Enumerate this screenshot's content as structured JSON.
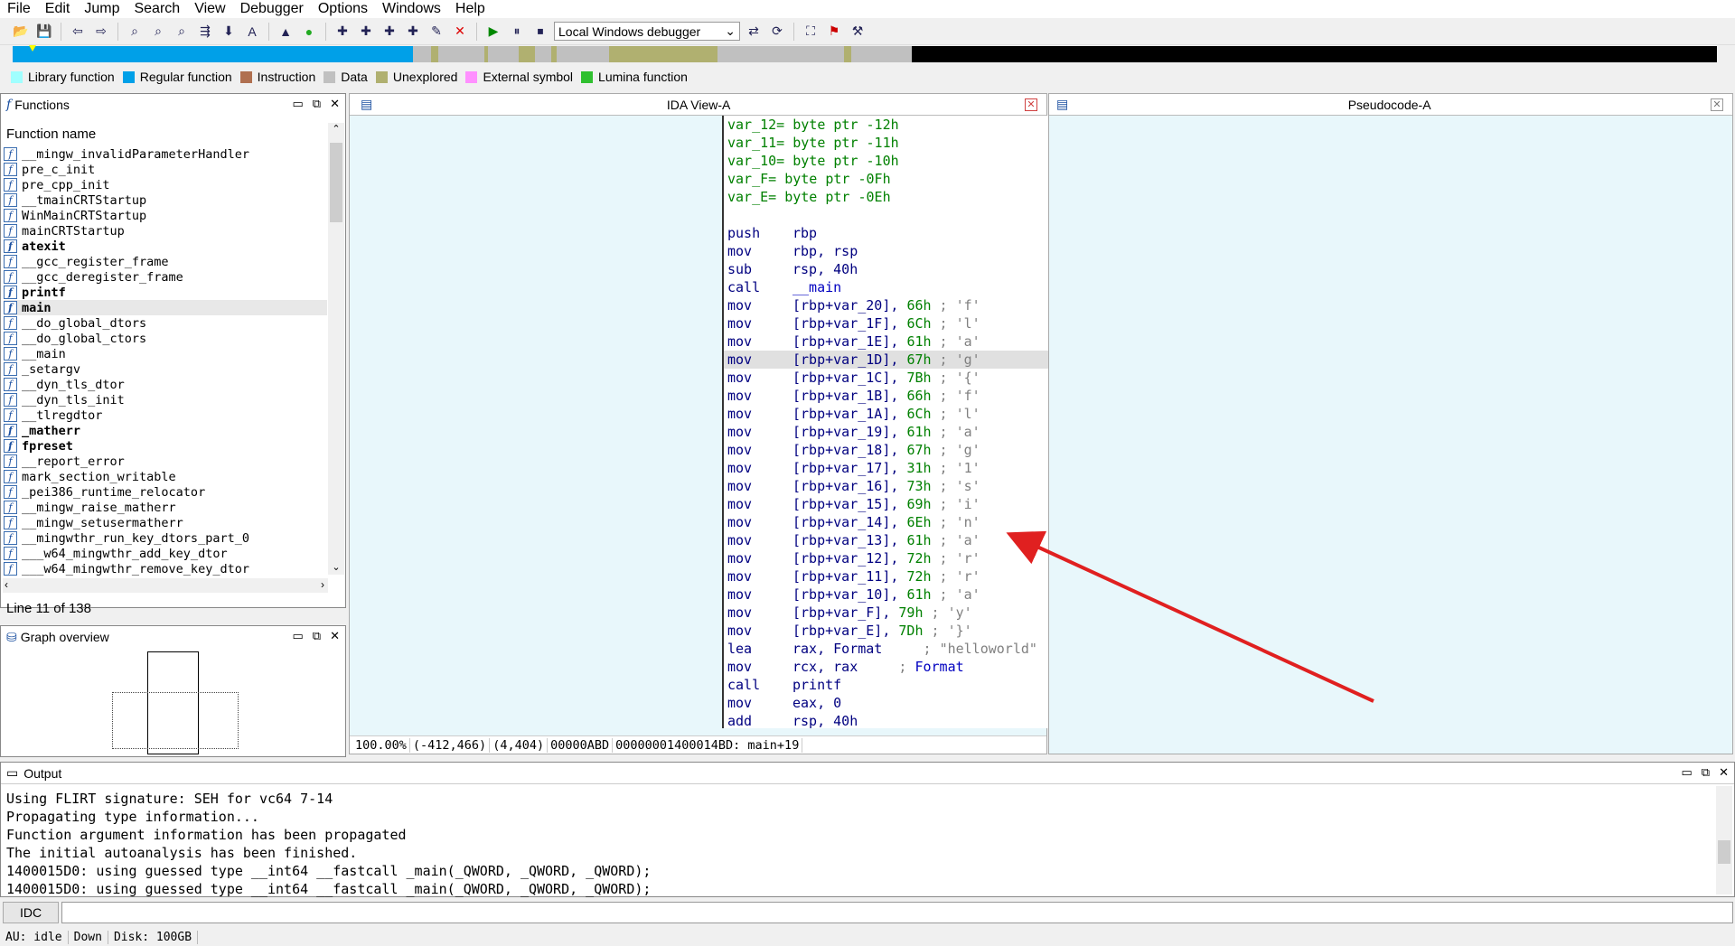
{
  "menu": [
    "File",
    "Edit",
    "Jump",
    "Search",
    "View",
    "Debugger",
    "Options",
    "Windows",
    "Help"
  ],
  "toolbar": {
    "debugger_select": "Local Windows debugger"
  },
  "legend": [
    {
      "label": "Library function",
      "color": "#a0ffff"
    },
    {
      "label": "Regular function",
      "color": "#00a0e8"
    },
    {
      "label": "Instruction",
      "color": "#b07050"
    },
    {
      "label": "Data",
      "color": "#c0c0c0"
    },
    {
      "label": "Unexplored",
      "color": "#b0b070"
    },
    {
      "label": "External symbol",
      "color": "#ff90ff"
    },
    {
      "label": "Lumina function",
      "color": "#30c030"
    }
  ],
  "functions": {
    "title": "Functions",
    "header": "Function name",
    "items": [
      {
        "name": "__mingw_invalidParameterHandler",
        "bold": false
      },
      {
        "name": "pre_c_init",
        "bold": false
      },
      {
        "name": "pre_cpp_init",
        "bold": false
      },
      {
        "name": "__tmainCRTStartup",
        "bold": false
      },
      {
        "name": "WinMainCRTStartup",
        "bold": false
      },
      {
        "name": "mainCRTStartup",
        "bold": false
      },
      {
        "name": "atexit",
        "bold": true
      },
      {
        "name": "__gcc_register_frame",
        "bold": false
      },
      {
        "name": "__gcc_deregister_frame",
        "bold": false
      },
      {
        "name": "printf",
        "bold": true
      },
      {
        "name": "main",
        "bold": true,
        "selected": true
      },
      {
        "name": "__do_global_dtors",
        "bold": false
      },
      {
        "name": "__do_global_ctors",
        "bold": false
      },
      {
        "name": "__main",
        "bold": false
      },
      {
        "name": "_setargv",
        "bold": false
      },
      {
        "name": "__dyn_tls_dtor",
        "bold": false
      },
      {
        "name": "__dyn_tls_init",
        "bold": false
      },
      {
        "name": "__tlregdtor",
        "bold": false
      },
      {
        "name": "_matherr",
        "bold": true
      },
      {
        "name": "fpreset",
        "bold": true
      },
      {
        "name": "__report_error",
        "bold": false
      },
      {
        "name": "mark_section_writable",
        "bold": false
      },
      {
        "name": "_pei386_runtime_relocator",
        "bold": false
      },
      {
        "name": "__mingw_raise_matherr",
        "bold": false
      },
      {
        "name": "__mingw_setusermatherr",
        "bold": false
      },
      {
        "name": "__mingwthr_run_key_dtors_part_0",
        "bold": false
      },
      {
        "name": "___w64_mingwthr_add_key_dtor",
        "bold": false
      },
      {
        "name": "___w64_mingwthr_remove_key_dtor",
        "bold": false
      }
    ],
    "status": "Line 11 of 138"
  },
  "graph_overview": {
    "title": "Graph overview"
  },
  "ida_view": {
    "title": "IDA View-A",
    "status": [
      "100.00%",
      "(-412,466)",
      "(4,404)",
      "00000ABD",
      "00000001400014BD: main+19"
    ]
  },
  "pseudocode": {
    "title": "Pseudocode-A"
  },
  "code_lines": [
    {
      "a": "var_12= byte ptr -12h",
      "t": "var"
    },
    {
      "a": "var_11= byte ptr -11h",
      "t": "var"
    },
    {
      "a": "var_10= byte ptr -10h",
      "t": "var"
    },
    {
      "a": "var_F= byte ptr -0Fh",
      "t": "var"
    },
    {
      "a": "var_E= byte ptr -0Eh",
      "t": "var"
    },
    {
      "a": "",
      "t": "blank"
    },
    {
      "m": "push",
      "o": "rbp"
    },
    {
      "m": "mov",
      "o": "rbp, rsp"
    },
    {
      "m": "sub",
      "o": "rsp, 40h"
    },
    {
      "m": "call",
      "o": "__main",
      "ref": true
    },
    {
      "m": "mov",
      "o": "[rbp+var_20]",
      "n": "66h",
      "c": "'f'"
    },
    {
      "m": "mov",
      "o": "[rbp+var_1F]",
      "n": "6Ch",
      "c": "'l'"
    },
    {
      "m": "mov",
      "o": "[rbp+var_1E]",
      "n": "61h",
      "c": "'a'"
    },
    {
      "m": "mov",
      "o": "[rbp+var_1D]",
      "n": "67h",
      "c": "'g'",
      "hl": true
    },
    {
      "m": "mov",
      "o": "[rbp+var_1C]",
      "n": "7Bh",
      "c": "'{'"
    },
    {
      "m": "mov",
      "o": "[rbp+var_1B]",
      "n": "66h",
      "c": "'f'"
    },
    {
      "m": "mov",
      "o": "[rbp+var_1A]",
      "n": "6Ch",
      "c": "'l'"
    },
    {
      "m": "mov",
      "o": "[rbp+var_19]",
      "n": "61h",
      "c": "'a'"
    },
    {
      "m": "mov",
      "o": "[rbp+var_18]",
      "n": "67h",
      "c": "'g'"
    },
    {
      "m": "mov",
      "o": "[rbp+var_17]",
      "n": "31h",
      "c": "'1'"
    },
    {
      "m": "mov",
      "o": "[rbp+var_16]",
      "n": "73h",
      "c": "'s'"
    },
    {
      "m": "mov",
      "o": "[rbp+var_15]",
      "n": "69h",
      "c": "'i'"
    },
    {
      "m": "mov",
      "o": "[rbp+var_14]",
      "n": "6Eh",
      "c": "'n'"
    },
    {
      "m": "mov",
      "o": "[rbp+var_13]",
      "n": "61h",
      "c": "'a'"
    },
    {
      "m": "mov",
      "o": "[rbp+var_12]",
      "n": "72h",
      "c": "'r'"
    },
    {
      "m": "mov",
      "o": "[rbp+var_11]",
      "n": "72h",
      "c": "'r'"
    },
    {
      "m": "mov",
      "o": "[rbp+var_10]",
      "n": "61h",
      "c": "'a'"
    },
    {
      "m": "mov",
      "o": "[rbp+var_F]",
      "n": "79h",
      "c": "'y'"
    },
    {
      "m": "mov",
      "o": "[rbp+var_E]",
      "n": "7Dh",
      "c": "'}'"
    },
    {
      "m": "lea",
      "o": "rax, Format",
      "c": "\"helloworld\""
    },
    {
      "m": "mov",
      "o": "rcx, rax",
      "c": "Format",
      "cref": true
    },
    {
      "m": "call",
      "o": "printf"
    },
    {
      "m": "mov",
      "o": "eax, 0"
    },
    {
      "m": "add",
      "o": "rsp, 40h"
    }
  ],
  "output": {
    "title": "Output",
    "lines": [
      "Using FLIRT signature: SEH for vc64 7-14",
      "Propagating type information...",
      "Function argument information has been propagated",
      "The initial autoanalysis has been finished.",
      "1400015D0: using guessed type __int64 __fastcall _main(_QWORD, _QWORD, _QWORD);",
      "1400015D0: using guessed type __int64 __fastcall _main(_QWORD, _QWORD, _QWORD);"
    ]
  },
  "idc": {
    "button": "IDC"
  },
  "statusbar": {
    "au": "AU:  idle",
    "dir": "Down",
    "disk": "Disk: 100GB"
  },
  "colors": {
    "accent_arrow": "#e02020",
    "code_bg": "#e8f7fb"
  }
}
